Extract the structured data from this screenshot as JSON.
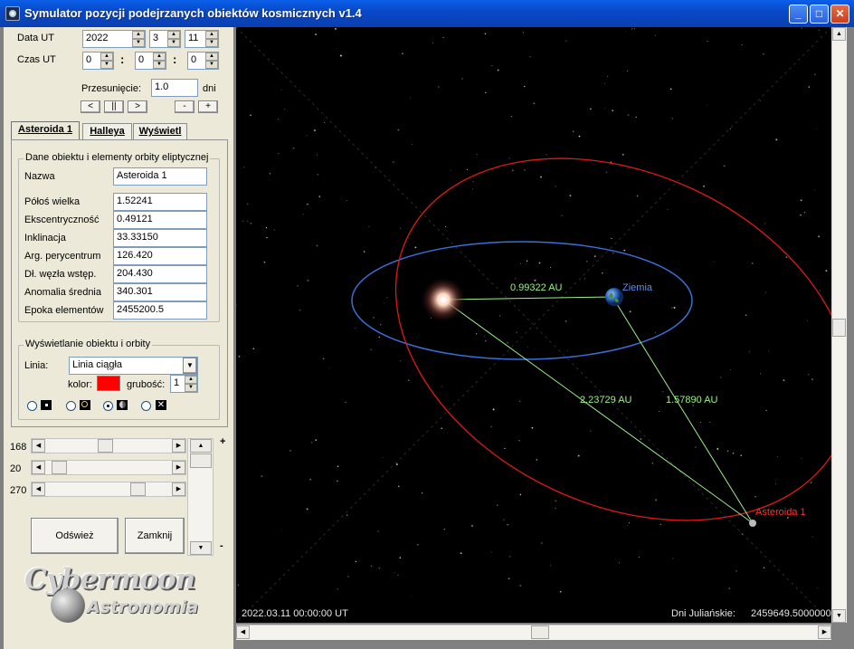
{
  "window": {
    "title": "Symulator pozycji podejrzanych obiektów kosmicznych v1.4"
  },
  "date": {
    "label": "Data UT",
    "year": "2022",
    "month": "3",
    "day": "11"
  },
  "time": {
    "label": "Czas UT",
    "hour": "0",
    "minute": "0",
    "second": "0",
    "sep": ":"
  },
  "shift": {
    "label": "Przesunięcie:",
    "value": "1.0",
    "unit": "dni"
  },
  "playback": {
    "prev": "<",
    "pause": "||",
    "next": ">",
    "minus": "-",
    "plus": "+"
  },
  "tabs": [
    "Asteroida 1",
    "Halleya",
    "Wyświetl"
  ],
  "orbit": {
    "group_title": "Dane obiektu i elementy orbity eliptycznej",
    "name_label": "Nazwa",
    "name_value": "Asteroida 1",
    "fields": [
      {
        "label": "Półoś wielka",
        "value": "1.52241"
      },
      {
        "label": "Ekscentryczność",
        "value": "0.49121"
      },
      {
        "label": "Inklinacja",
        "value": "33.33150"
      },
      {
        "label": "Arg. perycentrum",
        "value": "126.420"
      },
      {
        "label": "Dł. węzła wstęp.",
        "value": "204.430"
      },
      {
        "label": "Anomalia średnia",
        "value": "340.301"
      },
      {
        "label": "Epoka elementów",
        "value": "2455200.5"
      }
    ]
  },
  "display": {
    "group_title": "Wyświetlanie obiektu i orbity",
    "line_label": "Linia:",
    "line_value": "Linia ciągła",
    "color_label": "kolor:",
    "color_value": "#ff0000",
    "width_label": "grubość:",
    "width_value": "1",
    "selected_marker": 2
  },
  "rotation": [
    {
      "label": "168",
      "value": 168
    },
    {
      "label": "20",
      "value": 20
    },
    {
      "label": "270",
      "value": 270
    }
  ],
  "zoom": {
    "plus": "+",
    "minus": "-"
  },
  "buttons": {
    "refresh": "Odśwież",
    "close": "Zamknij"
  },
  "logo": {
    "line1": "Cybermoon",
    "line2": "Astronomia"
  },
  "scene": {
    "earth_label": "Ziemia",
    "asteroid_label": "Asteroida 1",
    "dist_sun_earth": "0.99322 AU",
    "dist_sun_asteroid": "2.23729 AU",
    "dist_earth_asteroid": "1.57890 AU",
    "datetime": "2022.03.11   00:00:00  UT",
    "jd_label": "Dni Juliańskie:",
    "jd_value": "2459649.50000000",
    "colors": {
      "earth_orbit": "#3b6fd8",
      "asteroid_orbit": "#e01818",
      "distance_lines": "#9df08a",
      "earth_text": "#5a8ff0",
      "asteroid_text": "#ff3030"
    }
  }
}
